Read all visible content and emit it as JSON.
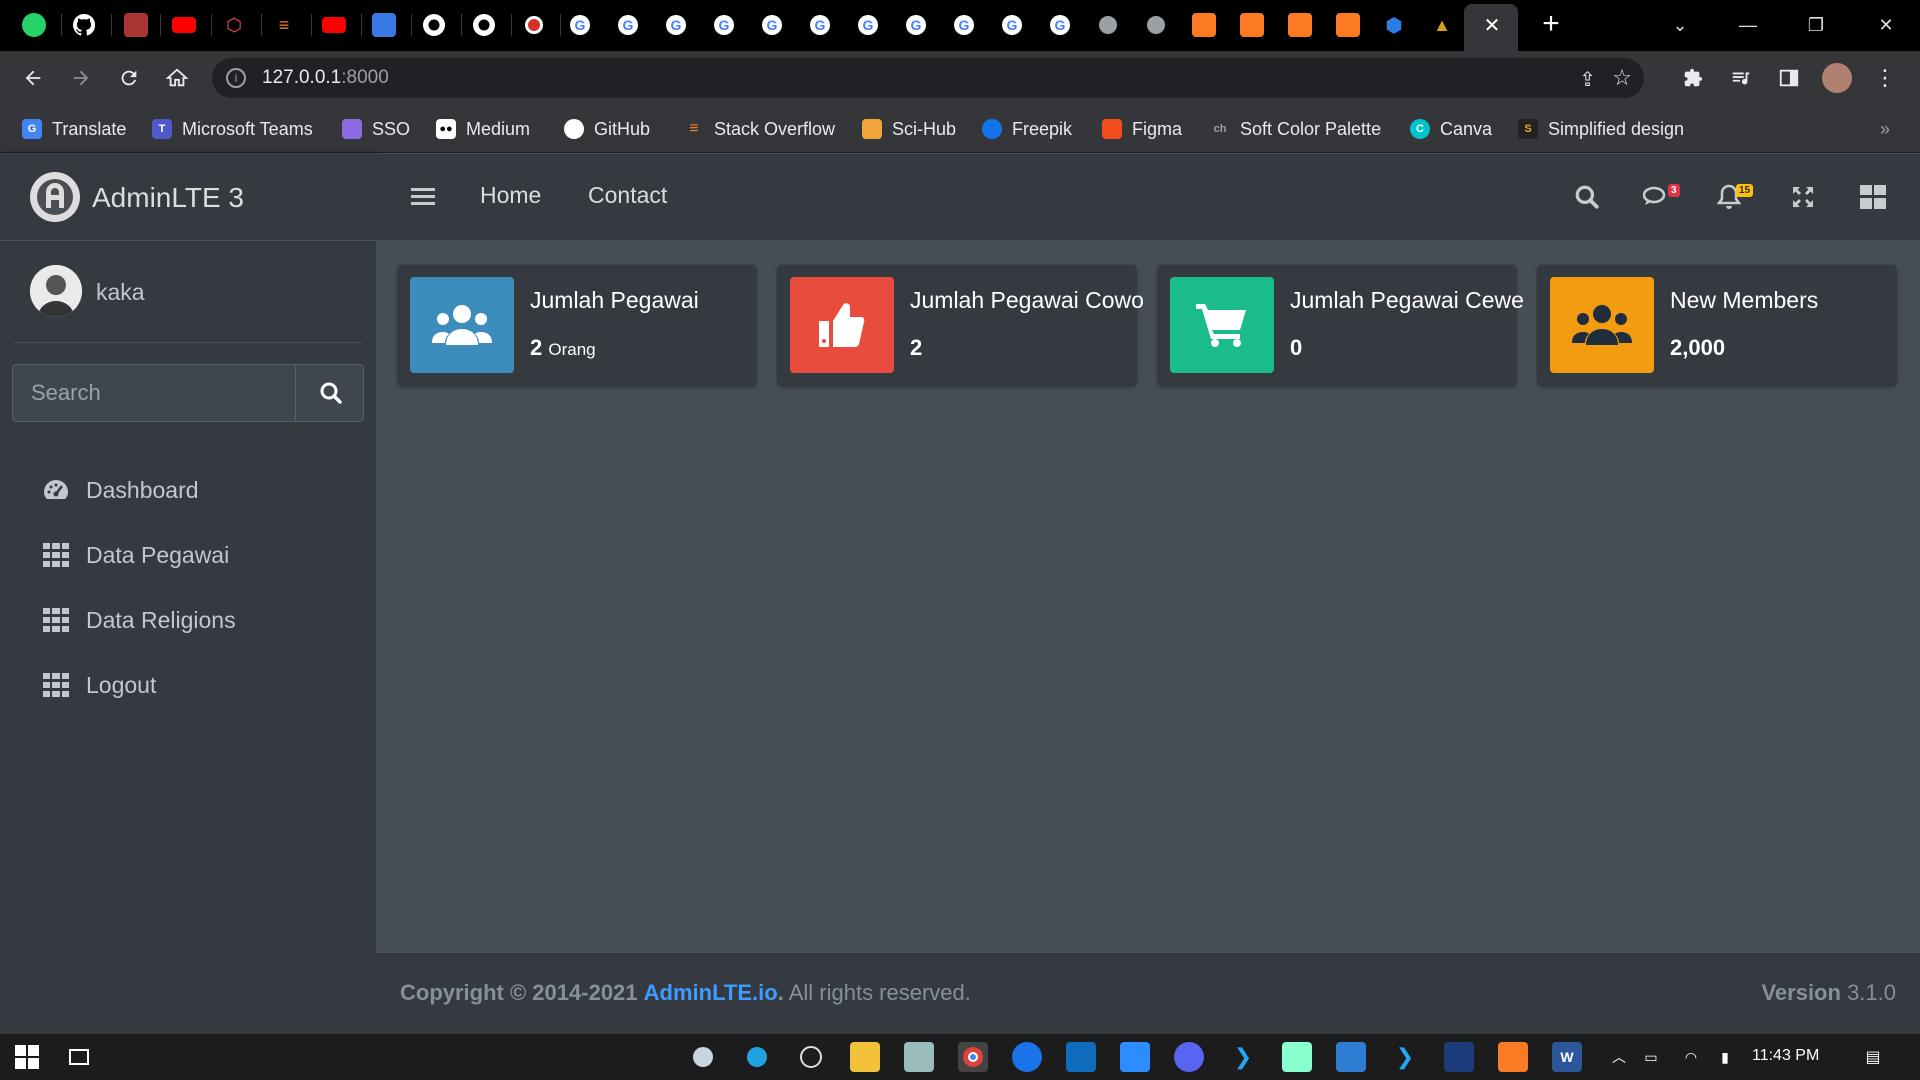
{
  "browser": {
    "url_host": "127.0.0.1",
    "url_port": ":8000",
    "tab_icons": [
      "whatsapp-icon",
      "github-icon",
      "user-icon",
      "youtube-icon",
      "laravel-icon",
      "stackoverflow-icon",
      "youtube-icon",
      "contacts-icon",
      "github-icon",
      "github-icon",
      "record-icon",
      "google-icon",
      "google-icon",
      "google-icon",
      "google-icon",
      "google-icon",
      "google-icon",
      "google-icon",
      "google-icon",
      "google-icon",
      "google-icon",
      "globe-icon",
      "globe-icon",
      "xampp-icon",
      "xampp-icon",
      "xampp-icon",
      "xampp-icon",
      "shield-icon",
      "chart-icon"
    ],
    "tab_close": "✕",
    "new_tab": "+"
  },
  "bookmarks": [
    {
      "label": "Translate",
      "icon": "google-translate-icon",
      "color": "#4285f4"
    },
    {
      "label": "Microsoft Teams",
      "icon": "teams-icon",
      "color": "#5059c9"
    },
    {
      "label": "SSO",
      "icon": "sso-icon",
      "color": "#8e6be0"
    },
    {
      "label": "Medium",
      "icon": "medium-icon",
      "color": "#ffffff"
    },
    {
      "label": "GitHub",
      "icon": "github-icon",
      "color": "#ffffff"
    },
    {
      "label": "Stack Overflow",
      "icon": "stackoverflow-icon",
      "color": "#f48024"
    },
    {
      "label": "Sci-Hub",
      "icon": "scihub-icon",
      "color": "#f2a33a"
    },
    {
      "label": "Freepik",
      "icon": "freepik-icon",
      "color": "#1273eb"
    },
    {
      "label": "Figma",
      "icon": "figma-icon",
      "color": "#f24e1e"
    },
    {
      "label": "Soft Color Palette",
      "icon": "ch-icon",
      "color": "#444444"
    },
    {
      "label": "Canva",
      "icon": "canva-icon",
      "color": "#00c4cc"
    },
    {
      "label": "Simplified design",
      "icon": "simplified-icon",
      "color": "#222222"
    }
  ],
  "app": {
    "brand": "AdminLTE 3",
    "user": "kaka",
    "search_placeholder": "Search",
    "nav": [
      {
        "label": "Dashboard",
        "icon": "tachometer-icon"
      },
      {
        "label": "Data Pegawai",
        "icon": "table-icon"
      },
      {
        "label": "Data Religions",
        "icon": "table-icon"
      },
      {
        "label": "Logout",
        "icon": "table-icon"
      }
    ],
    "topnav": {
      "home": "Home",
      "contact": "Contact"
    },
    "messages_badge": "3",
    "notifications_badge": "15",
    "info_boxes": [
      {
        "title": "Jumlah Pegawai",
        "value": "2",
        "unit": "Orang",
        "color": "#3c8dbc",
        "icon": "users-icon"
      },
      {
        "title": "Jumlah Pegawai Cowo",
        "value": "2",
        "unit": "",
        "color": "#e74c3c",
        "icon": "thumbs-up-icon"
      },
      {
        "title": "Jumlah Pegawai Cewe",
        "value": "0",
        "unit": "",
        "color": "#1abc8c",
        "icon": "cart-icon"
      },
      {
        "title": "New Members",
        "value": "2,000",
        "unit": "",
        "color": "#f39c12",
        "icon": "users-icon"
      }
    ],
    "footer": {
      "copyright_prefix": "Copyright © 2014-2021",
      "link": "AdminLTE.io",
      "suffix": ". All rights reserved.",
      "version_label": "Version",
      "version": "3.1.0"
    }
  },
  "taskbar": {
    "time": "11:43 PM"
  }
}
